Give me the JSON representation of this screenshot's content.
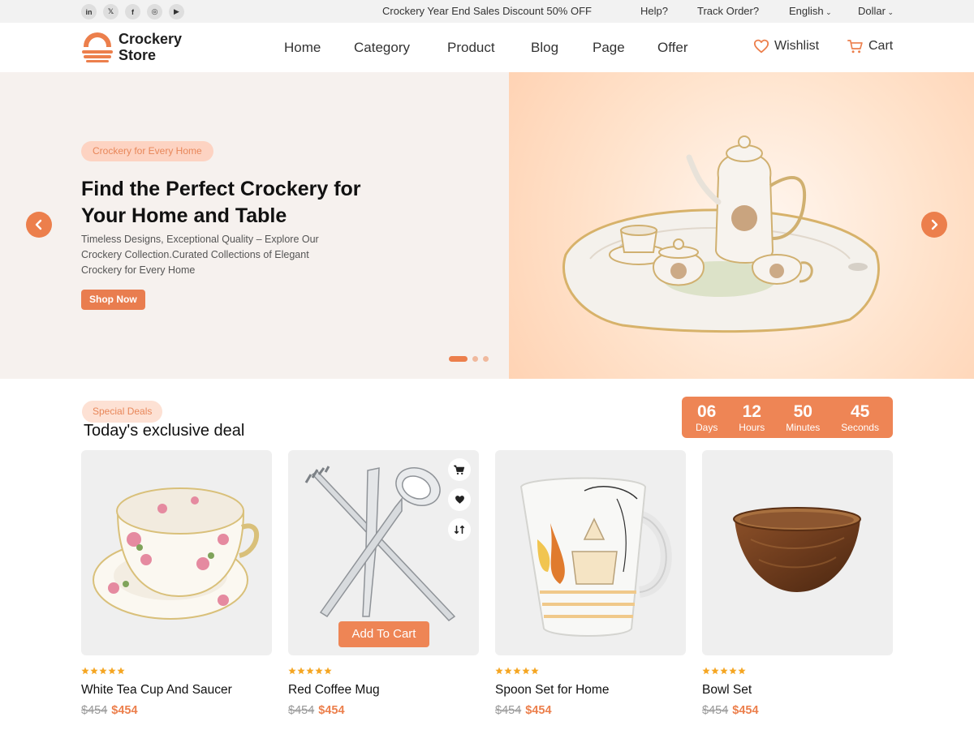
{
  "topbar": {
    "socials": [
      {
        "icon": "linkedin-icon",
        "glyph": "in"
      },
      {
        "icon": "x-icon",
        "glyph": "𝕏"
      },
      {
        "icon": "facebook-icon",
        "glyph": "f"
      },
      {
        "icon": "instagram-icon",
        "glyph": "◎"
      },
      {
        "icon": "youtube-icon",
        "glyph": "▶"
      }
    ],
    "promo": "Crockery Year End Sales Discount 50% OFF",
    "help": "Help?",
    "track": "Track Order?",
    "language": "English",
    "currency": "Dollar"
  },
  "header": {
    "logo_line1": "Crockery",
    "logo_line2": "Store",
    "nav": [
      "Home",
      "Category",
      "Product",
      "Blog",
      "Page",
      "Offer"
    ],
    "wishlist": "Wishlist",
    "cart": "Cart"
  },
  "hero": {
    "badge": "Crockery for Every Home",
    "title": "Find the Perfect Crockery for Your Home and Table",
    "description": "Timeless Designs, Exceptional Quality – Explore Our Crockery Collection.Curated Collections of Elegant Crockery for Every Home",
    "cta": "Shop Now",
    "slide_count": 3,
    "active_slide": 1
  },
  "deals": {
    "badge": "Special Deals",
    "title": "Today's exclusive deal",
    "countdown": [
      {
        "value": "06",
        "label": "Days"
      },
      {
        "value": "12",
        "label": "Hours"
      },
      {
        "value": "50",
        "label": "Minutes"
      },
      {
        "value": "45",
        "label": "Seconds"
      }
    ],
    "add_to_cart": "Add To Cart",
    "products": [
      {
        "name": "White Tea Cup And Saucer",
        "old_price": "$454",
        "price": "$454",
        "rating": 5
      },
      {
        "name": "Red Coffee Mug",
        "old_price": "$454",
        "price": "$454",
        "rating": 5
      },
      {
        "name": "Spoon Set for Home",
        "old_price": "$454",
        "price": "$454",
        "rating": 5
      },
      {
        "name": "Bowl Set",
        "old_price": "$454",
        "price": "$454",
        "rating": 5
      }
    ]
  },
  "colors": {
    "accent": "#EC7F4C",
    "badge_bg": "#FDD3C2",
    "star": "#F5A623"
  }
}
